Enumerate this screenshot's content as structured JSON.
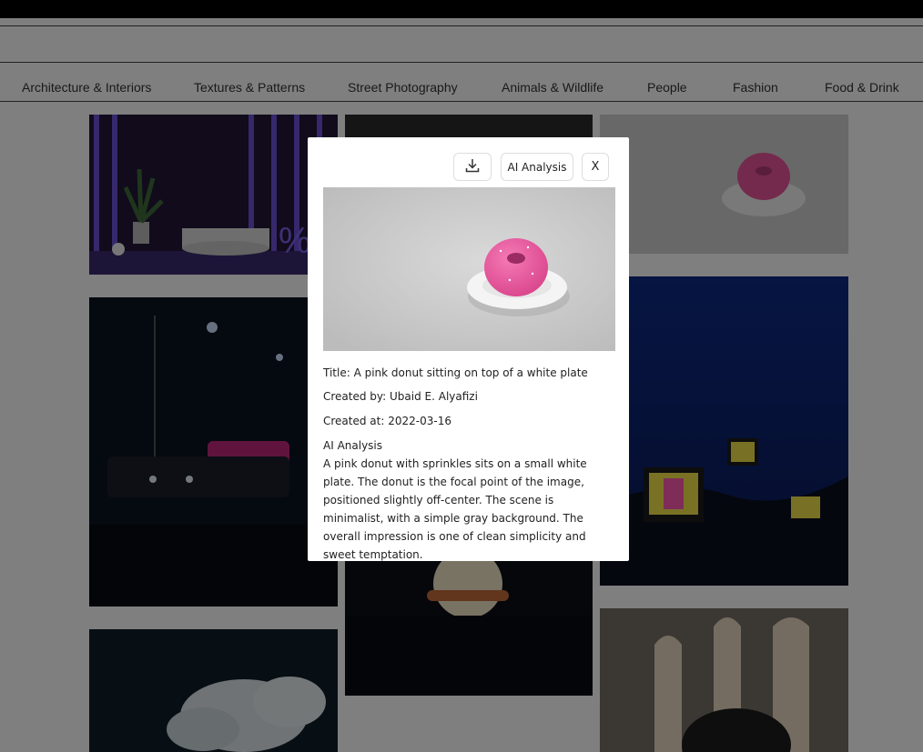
{
  "categories": [
    "Architecture & Interiors",
    "Textures & Patterns",
    "Street Photography",
    "Animals & Wildlife",
    "People",
    "Fashion",
    "Food & Drink"
  ],
  "modal": {
    "ai_button_label": "AI Analysis",
    "close_label": "X",
    "download_icon": "download-icon",
    "title_line": "Title: A pink donut sitting on top of a white plate",
    "created_by_line": "Created by: Ubaid E. Alyafizi",
    "created_at_line": "Created at: 2022-03-16",
    "analysis_heading": "AI Analysis",
    "analysis_text": "A pink donut with sprinkles sits on a small white plate. The donut is the focal point of the image, positioned slightly off-center. The scene is minimalist, with a simple gray background. The overall impression is one of clean simplicity and sweet temptation."
  },
  "colors": {
    "overlay": "#000000",
    "donut": "#e8559a",
    "accent_purple": "#5a3fb8",
    "night_blue": "#0d2a7a"
  }
}
